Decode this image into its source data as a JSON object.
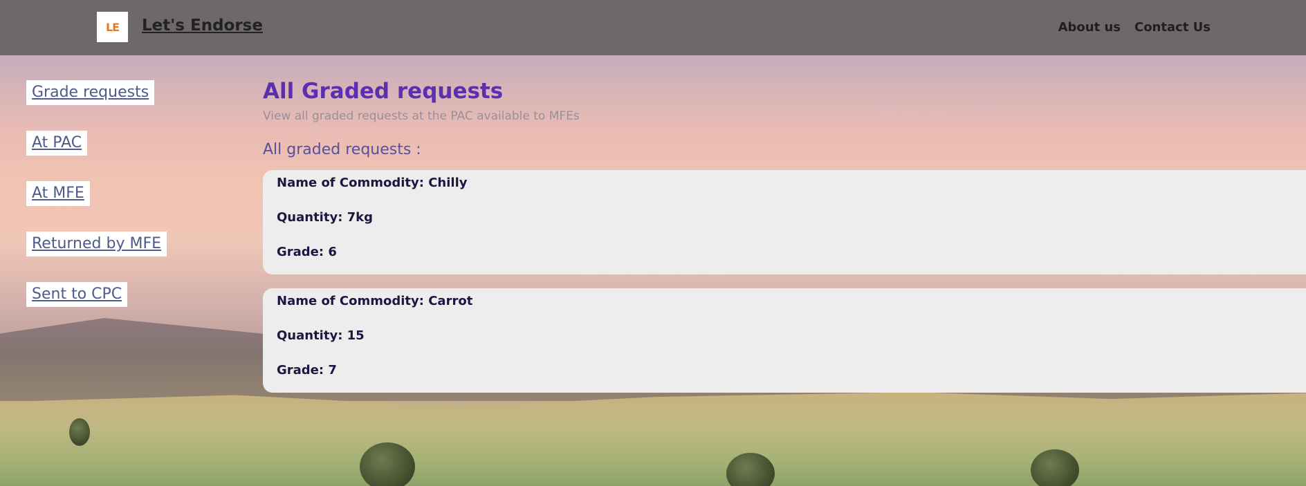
{
  "header": {
    "logo_text": "LE",
    "brand": "Let's Endorse",
    "nav": [
      "About us",
      "Contact Us"
    ]
  },
  "sidebar": {
    "items": [
      {
        "label": "Grade requests"
      },
      {
        "label": "At PAC"
      },
      {
        "label": "At MFE"
      },
      {
        "label": "Returned by MFE"
      },
      {
        "label": "Sent to CPC"
      }
    ]
  },
  "main": {
    "title": "All Graded requests",
    "subtitle": "View all graded requests at the PAC available to MFEs",
    "section_title": "All graded requests :",
    "requests": [
      {
        "commodity": "Name of Commodity: Chilly",
        "quantity": "Quantity: 7kg",
        "grade": "Grade: 6"
      },
      {
        "commodity": "Name of Commodity: Carrot",
        "quantity": "Quantity: 15",
        "grade": "Grade: 7"
      }
    ]
  },
  "colors": {
    "header_bg": "#6e6868",
    "title": "#5b2fb0",
    "card_bg": "#ededed",
    "sidebar_text": "#4e5a8a"
  }
}
